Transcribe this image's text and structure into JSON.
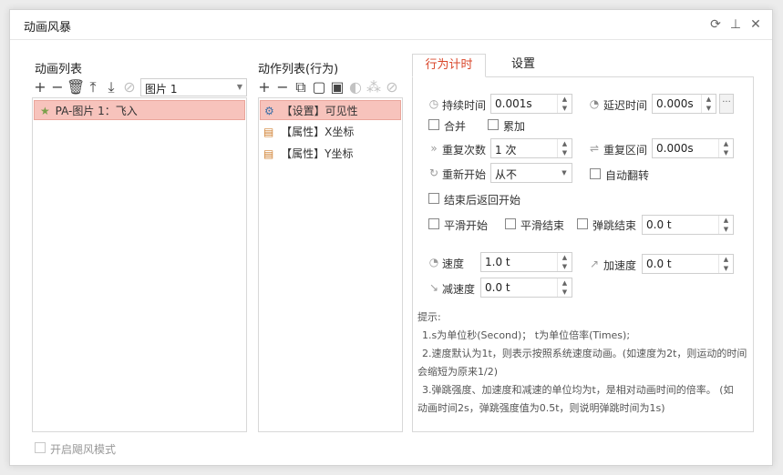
{
  "window": {
    "title": "动画风暴"
  },
  "left": {
    "header": "动画列表",
    "select_value": "图片 1",
    "items": [
      {
        "label": "PA-图片 1：飞入"
      }
    ]
  },
  "middle": {
    "header": "动作列表(行为)",
    "items": [
      {
        "label": "【设置】可见性"
      },
      {
        "label": "【属性】X坐标"
      },
      {
        "label": "【属性】Y坐标"
      }
    ]
  },
  "tabs": [
    {
      "label": "行为计时"
    },
    {
      "label": "设置"
    }
  ],
  "form": {
    "duration_label": "持续时间",
    "duration_value": "0.001s",
    "delay_label": "延迟时间",
    "delay_value": "0.000s",
    "merge_label": "合并",
    "accumulate_label": "累加",
    "repeat_count_label": "重复次数",
    "repeat_count_value": "1 次",
    "repeat_interval_label": "重复区间",
    "repeat_interval_value": "0.000s",
    "restart_label": "重新开始",
    "restart_value": "从不",
    "auto_reverse_label": "自动翻转",
    "return_after_end_label": "结束后返回开始",
    "smooth_start_label": "平滑开始",
    "smooth_end_label": "平滑结束",
    "bounce_end_label": "弹跳结束",
    "bounce_end_value": "0.0 t",
    "speed_label": "速度",
    "speed_value": "1.0 t",
    "accel_label": "加速度",
    "accel_value": "0.0 t",
    "decel_label": "减速度",
    "decel_value": "0.0 t"
  },
  "hints": {
    "title": "提示:",
    "line1": "1.s为单位秒(Second)； t为单位倍率(Times);",
    "line2a": "2.速度默认为1t，则表示按照系统速度动画。(如速度为2t，则运动的时间",
    "line2b": "会缩短为原来1/2)",
    "line3a": "3.弹跳强度、加速度和减速的单位均为t，是相对动画时间的倍率。 (如",
    "line3b": "动画时间2s，弹跳强度值为0.5t，则说明弹跳时间为1s)"
  },
  "footer": {
    "typhoon_mode_label": "开启飓风模式"
  },
  "colors": {
    "accent": "#d9472b",
    "selection_bg": "#f7c3bc"
  }
}
